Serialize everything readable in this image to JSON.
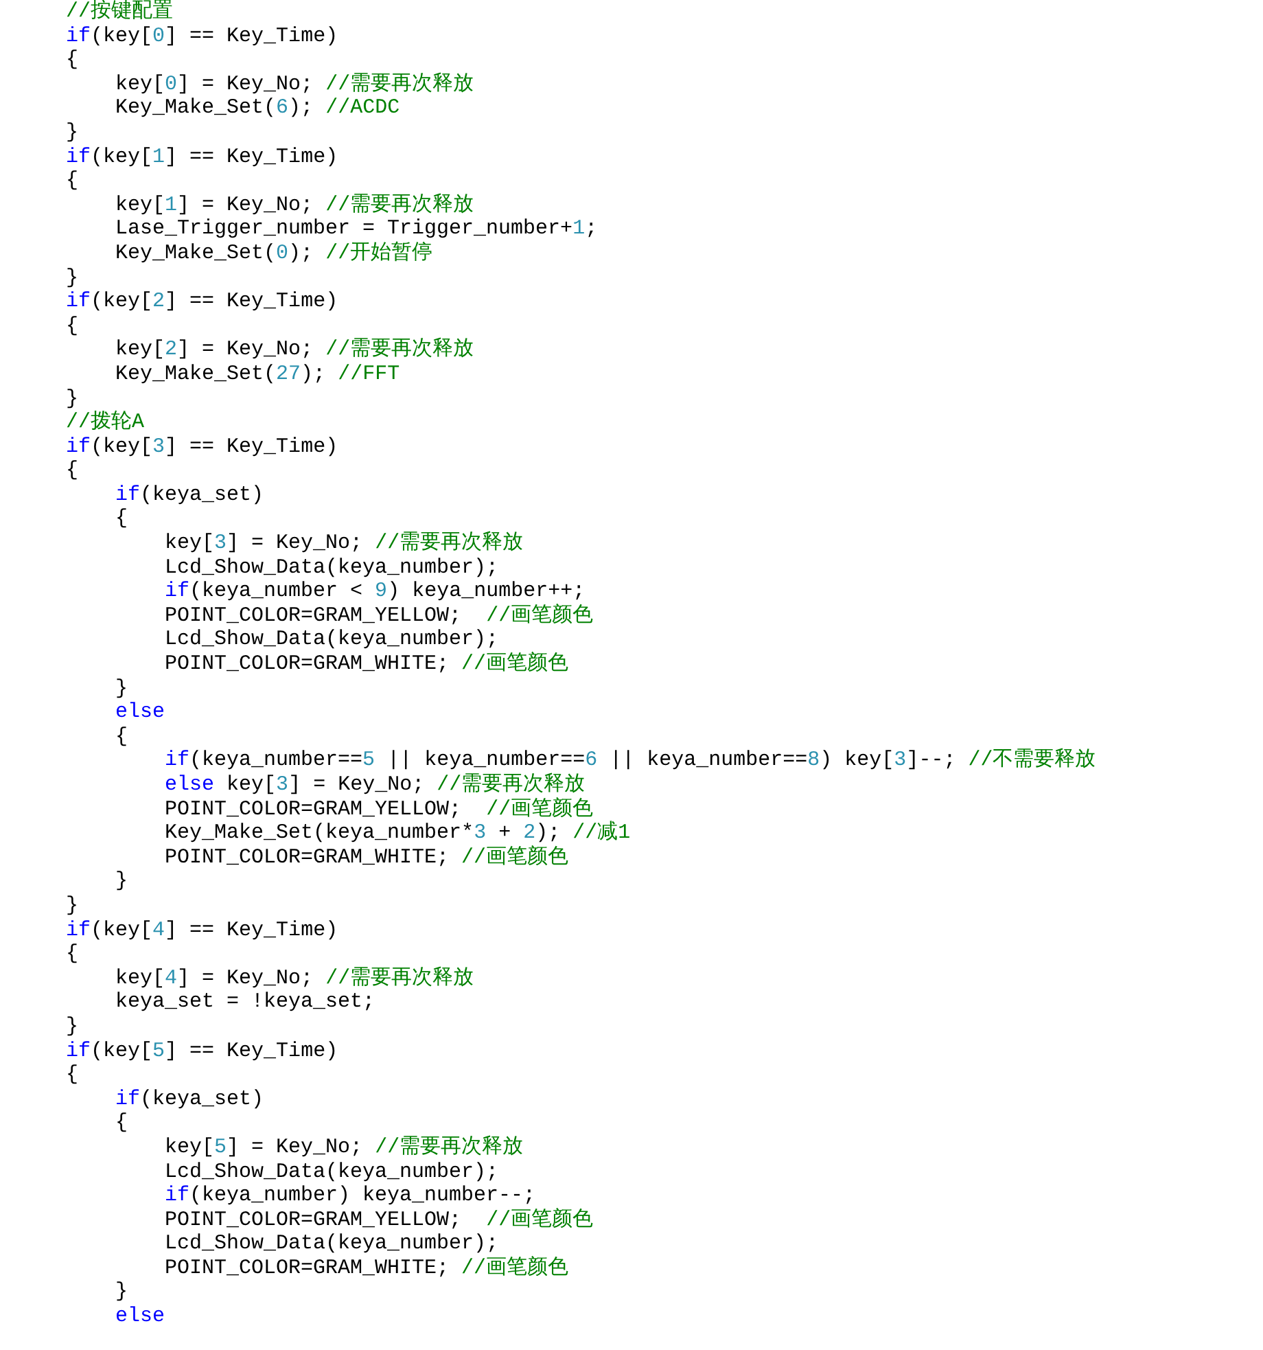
{
  "editor": {
    "lines": [
      {
        "tokens": [
          {
            "kind": "comment",
            "text": "//按键配置"
          }
        ]
      },
      {
        "tokens": [
          {
            "kind": "keyword",
            "text": "if"
          },
          {
            "kind": "plain",
            "text": "(key["
          },
          {
            "kind": "number",
            "text": "0"
          },
          {
            "kind": "plain",
            "text": "] == Key_Time)"
          }
        ]
      },
      {
        "tokens": [
          {
            "kind": "plain",
            "text": "{"
          }
        ]
      },
      {
        "tokens": [
          {
            "kind": "plain",
            "text": "    key["
          },
          {
            "kind": "number",
            "text": "0"
          },
          {
            "kind": "plain",
            "text": "] = Key_No; "
          },
          {
            "kind": "comment",
            "text": "//需要再次释放"
          }
        ]
      },
      {
        "tokens": [
          {
            "kind": "plain",
            "text": "    Key_Make_Set("
          },
          {
            "kind": "number",
            "text": "6"
          },
          {
            "kind": "plain",
            "text": "); "
          },
          {
            "kind": "comment",
            "text": "//ACDC"
          }
        ]
      },
      {
        "tokens": [
          {
            "kind": "plain",
            "text": "}"
          }
        ]
      },
      {
        "tokens": [
          {
            "kind": "keyword",
            "text": "if"
          },
          {
            "kind": "plain",
            "text": "(key["
          },
          {
            "kind": "number",
            "text": "1"
          },
          {
            "kind": "plain",
            "text": "] == Key_Time)"
          }
        ]
      },
      {
        "tokens": [
          {
            "kind": "plain",
            "text": "{"
          }
        ]
      },
      {
        "tokens": [
          {
            "kind": "plain",
            "text": "    key["
          },
          {
            "kind": "number",
            "text": "1"
          },
          {
            "kind": "plain",
            "text": "] = Key_No; "
          },
          {
            "kind": "comment",
            "text": "//需要再次释放"
          }
        ]
      },
      {
        "tokens": [
          {
            "kind": "plain",
            "text": "    Lase_Trigger_number = Trigger_number+"
          },
          {
            "kind": "number",
            "text": "1"
          },
          {
            "kind": "plain",
            "text": ";"
          }
        ]
      },
      {
        "tokens": [
          {
            "kind": "plain",
            "text": "    Key_Make_Set("
          },
          {
            "kind": "number",
            "text": "0"
          },
          {
            "kind": "plain",
            "text": "); "
          },
          {
            "kind": "comment",
            "text": "//开始暂停"
          }
        ]
      },
      {
        "tokens": [
          {
            "kind": "plain",
            "text": "}"
          }
        ]
      },
      {
        "tokens": [
          {
            "kind": "keyword",
            "text": "if"
          },
          {
            "kind": "plain",
            "text": "(key["
          },
          {
            "kind": "number",
            "text": "2"
          },
          {
            "kind": "plain",
            "text": "] == Key_Time)"
          }
        ]
      },
      {
        "tokens": [
          {
            "kind": "plain",
            "text": "{"
          }
        ]
      },
      {
        "tokens": [
          {
            "kind": "plain",
            "text": "    key["
          },
          {
            "kind": "number",
            "text": "2"
          },
          {
            "kind": "plain",
            "text": "] = Key_No; "
          },
          {
            "kind": "comment",
            "text": "//需要再次释放"
          }
        ]
      },
      {
        "tokens": [
          {
            "kind": "plain",
            "text": "    Key_Make_Set("
          },
          {
            "kind": "number",
            "text": "27"
          },
          {
            "kind": "plain",
            "text": "); "
          },
          {
            "kind": "comment",
            "text": "//FFT"
          }
        ]
      },
      {
        "tokens": [
          {
            "kind": "plain",
            "text": "}"
          }
        ]
      },
      {
        "tokens": [
          {
            "kind": "comment",
            "text": "//拨轮A"
          }
        ]
      },
      {
        "tokens": [
          {
            "kind": "keyword",
            "text": "if"
          },
          {
            "kind": "plain",
            "text": "(key["
          },
          {
            "kind": "number",
            "text": "3"
          },
          {
            "kind": "plain",
            "text": "] == Key_Time)"
          }
        ]
      },
      {
        "tokens": [
          {
            "kind": "plain",
            "text": "{"
          }
        ]
      },
      {
        "tokens": [
          {
            "kind": "keyword",
            "text": "    if"
          },
          {
            "kind": "plain",
            "text": "(keya_set)"
          }
        ]
      },
      {
        "tokens": [
          {
            "kind": "plain",
            "text": "    {"
          }
        ]
      },
      {
        "tokens": [
          {
            "kind": "plain",
            "text": "        key["
          },
          {
            "kind": "number",
            "text": "3"
          },
          {
            "kind": "plain",
            "text": "] = Key_No; "
          },
          {
            "kind": "comment",
            "text": "//需要再次释放"
          }
        ]
      },
      {
        "tokens": [
          {
            "kind": "plain",
            "text": "        Lcd_Show_Data(keya_number);"
          }
        ]
      },
      {
        "tokens": [
          {
            "kind": "keyword",
            "text": "        if"
          },
          {
            "kind": "plain",
            "text": "(keya_number < "
          },
          {
            "kind": "number",
            "text": "9"
          },
          {
            "kind": "plain",
            "text": ") keya_number++;"
          }
        ]
      },
      {
        "tokens": [
          {
            "kind": "plain",
            "text": "        POINT_COLOR=GRAM_YELLOW;  "
          },
          {
            "kind": "comment",
            "text": "//画笔颜色"
          }
        ]
      },
      {
        "tokens": [
          {
            "kind": "plain",
            "text": "        Lcd_Show_Data(keya_number);"
          }
        ]
      },
      {
        "tokens": [
          {
            "kind": "plain",
            "text": "        POINT_COLOR=GRAM_WHITE; "
          },
          {
            "kind": "comment",
            "text": "//画笔颜色"
          }
        ]
      },
      {
        "tokens": [
          {
            "kind": "plain",
            "text": "    }"
          }
        ]
      },
      {
        "tokens": [
          {
            "kind": "keyword",
            "text": "    else"
          }
        ]
      },
      {
        "tokens": [
          {
            "kind": "plain",
            "text": "    {"
          }
        ]
      },
      {
        "tokens": [
          {
            "kind": "keyword",
            "text": "        if"
          },
          {
            "kind": "plain",
            "text": "(keya_number=="
          },
          {
            "kind": "number",
            "text": "5"
          },
          {
            "kind": "plain",
            "text": " || keya_number=="
          },
          {
            "kind": "number",
            "text": "6"
          },
          {
            "kind": "plain",
            "text": " || keya_number=="
          },
          {
            "kind": "number",
            "text": "8"
          },
          {
            "kind": "plain",
            "text": ") key["
          },
          {
            "kind": "number",
            "text": "3"
          },
          {
            "kind": "plain",
            "text": "]--; "
          },
          {
            "kind": "comment",
            "text": "//不需要释放"
          }
        ]
      },
      {
        "tokens": [
          {
            "kind": "keyword",
            "text": "        else"
          },
          {
            "kind": "plain",
            "text": " key["
          },
          {
            "kind": "number",
            "text": "3"
          },
          {
            "kind": "plain",
            "text": "] = Key_No; "
          },
          {
            "kind": "comment",
            "text": "//需要再次释放"
          }
        ]
      },
      {
        "tokens": [
          {
            "kind": "plain",
            "text": "        POINT_COLOR=GRAM_YELLOW;  "
          },
          {
            "kind": "comment",
            "text": "//画笔颜色"
          }
        ]
      },
      {
        "tokens": [
          {
            "kind": "plain",
            "text": "        Key_Make_Set(keya_number*"
          },
          {
            "kind": "number",
            "text": "3"
          },
          {
            "kind": "plain",
            "text": " + "
          },
          {
            "kind": "number",
            "text": "2"
          },
          {
            "kind": "plain",
            "text": "); "
          },
          {
            "kind": "comment",
            "text": "//减1"
          }
        ]
      },
      {
        "tokens": [
          {
            "kind": "plain",
            "text": "        POINT_COLOR=GRAM_WHITE; "
          },
          {
            "kind": "comment",
            "text": "//画笔颜色"
          }
        ]
      },
      {
        "tokens": [
          {
            "kind": "plain",
            "text": "    }"
          }
        ]
      },
      {
        "tokens": [
          {
            "kind": "plain",
            "text": "}"
          }
        ]
      },
      {
        "tokens": [
          {
            "kind": "keyword",
            "text": "if"
          },
          {
            "kind": "plain",
            "text": "(key["
          },
          {
            "kind": "number",
            "text": "4"
          },
          {
            "kind": "plain",
            "text": "] == Key_Time)"
          }
        ]
      },
      {
        "tokens": [
          {
            "kind": "plain",
            "text": "{"
          }
        ]
      },
      {
        "tokens": [
          {
            "kind": "plain",
            "text": "    key["
          },
          {
            "kind": "number",
            "text": "4"
          },
          {
            "kind": "plain",
            "text": "] = Key_No; "
          },
          {
            "kind": "comment",
            "text": "//需要再次释放"
          }
        ]
      },
      {
        "tokens": [
          {
            "kind": "plain",
            "text": "    keya_set = !keya_set;"
          }
        ]
      },
      {
        "tokens": [
          {
            "kind": "plain",
            "text": "}"
          }
        ]
      },
      {
        "tokens": [
          {
            "kind": "keyword",
            "text": "if"
          },
          {
            "kind": "plain",
            "text": "(key["
          },
          {
            "kind": "number",
            "text": "5"
          },
          {
            "kind": "plain",
            "text": "] == Key_Time)"
          }
        ]
      },
      {
        "tokens": [
          {
            "kind": "plain",
            "text": "{"
          }
        ]
      },
      {
        "tokens": [
          {
            "kind": "keyword",
            "text": "    if"
          },
          {
            "kind": "plain",
            "text": "(keya_set)"
          }
        ]
      },
      {
        "tokens": [
          {
            "kind": "plain",
            "text": "    {"
          }
        ]
      },
      {
        "tokens": [
          {
            "kind": "plain",
            "text": "        key["
          },
          {
            "kind": "number",
            "text": "5"
          },
          {
            "kind": "plain",
            "text": "] = Key_No; "
          },
          {
            "kind": "comment",
            "text": "//需要再次释放"
          }
        ]
      },
      {
        "tokens": [
          {
            "kind": "plain",
            "text": "        Lcd_Show_Data(keya_number);"
          }
        ]
      },
      {
        "tokens": [
          {
            "kind": "keyword",
            "text": "        if"
          },
          {
            "kind": "plain",
            "text": "(keya_number) keya_number--;"
          }
        ]
      },
      {
        "tokens": [
          {
            "kind": "plain",
            "text": "        POINT_COLOR=GRAM_YELLOW;  "
          },
          {
            "kind": "comment",
            "text": "//画笔颜色"
          }
        ]
      },
      {
        "tokens": [
          {
            "kind": "plain",
            "text": "        Lcd_Show_Data(keya_number);"
          }
        ]
      },
      {
        "tokens": [
          {
            "kind": "plain",
            "text": "        POINT_COLOR=GRAM_WHITE; "
          },
          {
            "kind": "comment",
            "text": "//画笔颜色"
          }
        ]
      },
      {
        "tokens": [
          {
            "kind": "plain",
            "text": "    }"
          }
        ]
      },
      {
        "tokens": [
          {
            "kind": "keyword",
            "text": "    else"
          }
        ]
      }
    ]
  }
}
